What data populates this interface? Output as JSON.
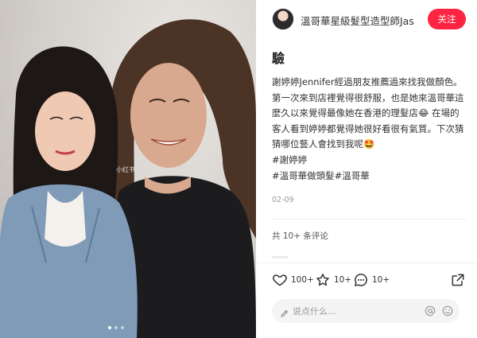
{
  "photo": {
    "watermark": "小红书",
    "carousel_dots": 3,
    "active_dot": 0
  },
  "header": {
    "author_name": "溫哥華星級髮型造型師Jas",
    "follow_label": "关注"
  },
  "post": {
    "title": "驗",
    "body_lines": [
      "謝婷婷Jennifer經過朋友推薦過來找我做顏色。",
      "第一次來到店裡覺得很舒服，也是她來溫哥華這",
      "麼久以來覺得最像她在香港的理髮店😂 在場的",
      "客人看到婷婷都覺得她很好看很有氣質。下次猜",
      "猜哪位藝人會找到我呢🤩"
    ],
    "tag_line_1": "#謝婷婷",
    "tag_line_2": "#溫哥華做頭髮#溫哥華",
    "date": "02-09"
  },
  "comments": {
    "count_label": "共 10+ 条评论"
  },
  "actions": {
    "like_count": "100+",
    "collect_count": "10+",
    "comment_count": "10+"
  },
  "comment_input": {
    "placeholder": "说点什么..."
  },
  "colors": {
    "brand_red": "#ff2442",
    "text": "#333333",
    "muted": "#999999"
  },
  "icons": {
    "like": "heart-icon",
    "collect": "star-icon",
    "comment": "chat-bubble-icon",
    "share": "share-icon",
    "input": "pencil-icon",
    "mention": "at-icon",
    "emoji": "smiley-icon"
  }
}
